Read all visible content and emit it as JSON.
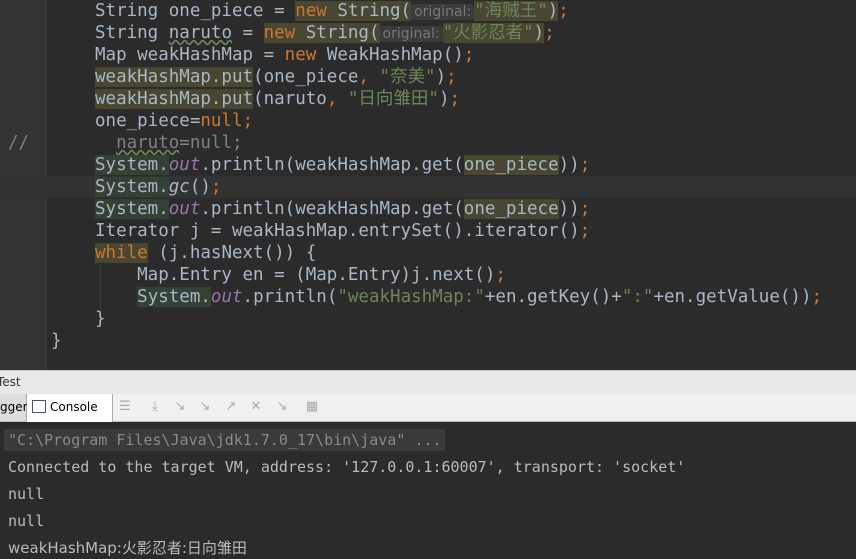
{
  "editor": {
    "lines": [
      [
        [
          "",
          "String one_piece = "
        ],
        [
          "kw hl",
          "new "
        ],
        [
          "hl",
          "String("
        ],
        [
          "hint",
          "original:"
        ],
        [
          "str hl",
          "\"海贼王\""
        ],
        [
          "hl",
          ")"
        ],
        [
          "kw",
          ";"
        ]
      ],
      [
        [
          "",
          "String "
        ],
        [
          "wavy",
          "naruto"
        ],
        [
          "",
          " = "
        ],
        [
          "kw hl",
          "new "
        ],
        [
          "hl",
          "String("
        ],
        [
          "hint",
          "original:"
        ],
        [
          "str hl",
          "\"火影忍者\""
        ],
        [
          "hl",
          ")"
        ],
        [
          "kw",
          ";"
        ]
      ],
      [
        [
          "",
          "Map weakHashMap = "
        ],
        [
          "kw",
          "new "
        ],
        [
          "",
          "WeakHashMap()"
        ],
        [
          "kw",
          ";"
        ]
      ],
      [
        [
          "hl",
          "weakHashMap.put"
        ],
        [
          "",
          "(one_piece"
        ],
        [
          "kw",
          ", "
        ],
        [
          "str",
          "\"奈美\""
        ],
        [
          "",
          ")"
        ],
        [
          "kw",
          ";"
        ]
      ],
      [
        [
          "hl",
          "weakHashMap.put"
        ],
        [
          "",
          "(naruto"
        ],
        [
          "kw",
          ", "
        ],
        [
          "str",
          "\"日向雏田\""
        ],
        [
          "",
          ")"
        ],
        [
          "kw",
          ";"
        ]
      ],
      [
        [
          "",
          "one_piece="
        ],
        [
          "kw",
          "null;"
        ]
      ],
      [
        [
          "cmt",
          "  "
        ],
        [
          "cmt wavy",
          "naruto"
        ],
        [
          "cmt",
          "=null;"
        ]
      ],
      [
        [
          "hl2",
          "System."
        ],
        [
          "fld",
          "out"
        ],
        [
          "",
          ".println(weakHashMap.get("
        ],
        [
          "hl",
          "one_piece"
        ],
        [
          "",
          "))"
        ],
        [
          "kw",
          ";"
        ]
      ],
      [
        [
          "hl2",
          "System."
        ],
        [
          "it",
          "gc"
        ],
        [
          "",
          "()"
        ],
        [
          "kw",
          ";"
        ]
      ],
      [
        [
          "hl2",
          "System."
        ],
        [
          "fld",
          "out"
        ],
        [
          "",
          ".println(weakHashMap.get("
        ],
        [
          "hl",
          "one_piece"
        ],
        [
          "",
          "))"
        ],
        [
          "kw",
          ";"
        ]
      ],
      [
        [
          "",
          "Iterator j = weakHashMap.entrySet().iterator()"
        ],
        [
          "kw",
          ";"
        ]
      ],
      [
        [
          "kw hl",
          "while"
        ],
        [
          "",
          " (j.hasNext()) {"
        ]
      ],
      [
        [
          "",
          "    Map.Entry en = (Map.Entry)j.next()"
        ],
        [
          "kw",
          ";"
        ]
      ],
      [
        [
          "",
          "    "
        ],
        [
          "hl2",
          "System."
        ],
        [
          "fld",
          "out"
        ],
        [
          "",
          ".println("
        ],
        [
          "str",
          "\"weakHashMap:\""
        ],
        [
          "",
          "+en.getKey()+"
        ],
        [
          "str",
          "\":\""
        ],
        [
          "",
          "+en.getValue())"
        ],
        [
          "kw",
          ";"
        ]
      ],
      [
        [
          "",
          "}"
        ]
      ],
      [
        [
          "",
          "}"
        ]
      ]
    ],
    "comment_marker": "//"
  },
  "panel": {
    "title": "Test",
    "tabs": {
      "debugger": "gger",
      "console": "Console",
      "console_pin": "→•"
    }
  },
  "console": {
    "lines": [
      "\"C:\\Program Files\\Java\\jdk1.7.0_17\\bin\\java\" ...",
      "Connected to the target VM, address: '127.0.0.1:60007', transport: 'socket'",
      "null",
      "null",
      "weakHashMap:火影忍者:日向雏田"
    ]
  }
}
